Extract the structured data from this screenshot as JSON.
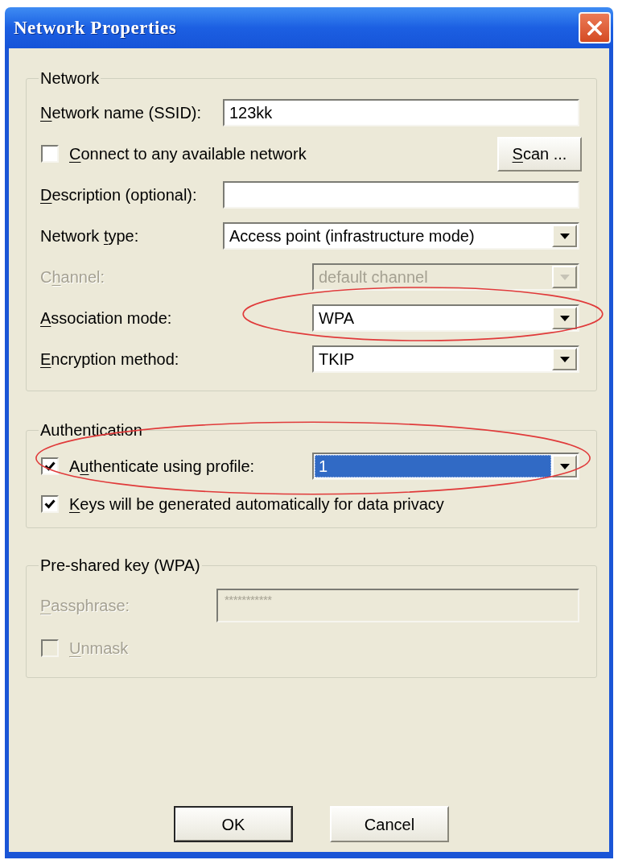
{
  "window": {
    "title": "Network Properties"
  },
  "network": {
    "legend": "Network",
    "rows": [
      {
        "kind": "text",
        "label": {
          "key": "N",
          "post": "etwork name (SSID):"
        },
        "value": "123kk",
        "disabled": false,
        "circled": false
      },
      {
        "kind": "checkbox",
        "label": {
          "key": "C",
          "post": "onnect to any available network"
        },
        "checked": false,
        "disabled": false,
        "circled": false,
        "button": {
          "key": "S",
          "post": "can ..."
        }
      },
      {
        "kind": "text",
        "label": {
          "key": "D",
          "post": "escription (optional):"
        },
        "disabled": false,
        "circled": false
      },
      {
        "kind": "select",
        "label": {
          "pre": "Network ",
          "key": "t",
          "post": "ype:"
        },
        "value": "Access point (infrastructure mode)",
        "disabled": false,
        "focused": false,
        "circled": false
      },
      {
        "kind": "narrow_select",
        "label": {
          "pre": "C",
          "key": "h",
          "post": "annel:"
        },
        "value": "default channel",
        "disabled": true,
        "focused": false,
        "circled": false
      },
      {
        "kind": "narrow_select",
        "label": {
          "key": "A",
          "post": "ssociation mode:"
        },
        "value": "WPA",
        "disabled": false,
        "focused": false,
        "circled": true
      },
      {
        "kind": "narrow_select",
        "label": {
          "key": "E",
          "post": "ncryption method:"
        },
        "value": "TKIP",
        "disabled": false,
        "focused": false,
        "circled": false
      }
    ]
  },
  "authentication": {
    "legend": "Authentication",
    "rows": [
      {
        "kind": "checkbox_select",
        "label": {
          "pre": "A",
          "key": "u",
          "post": "thenticate using profile:"
        },
        "checked": true,
        "value": "1",
        "disabled": false,
        "focused": true,
        "circled": true
      },
      {
        "kind": "checkbox",
        "label": {
          "key": "K",
          "post": "eys will be generated automatically for data privacy"
        },
        "checked": true,
        "disabled": false,
        "circled": false
      }
    ]
  },
  "pre_shared_key": {
    "legend": "Pre-shared key (WPA)",
    "rows": [
      {
        "kind": "password",
        "label": {
          "key": "P",
          "post": "assphrase:"
        },
        "value": "***********",
        "disabled": true,
        "circled": false
      },
      {
        "kind": "checkbox",
        "label": {
          "key": "U",
          "post": "nmask"
        },
        "checked": false,
        "disabled": true,
        "circled": false
      }
    ]
  },
  "buttons": [
    {
      "label": "OK",
      "default": true
    },
    {
      "label": "Cancel",
      "default": false
    }
  ]
}
